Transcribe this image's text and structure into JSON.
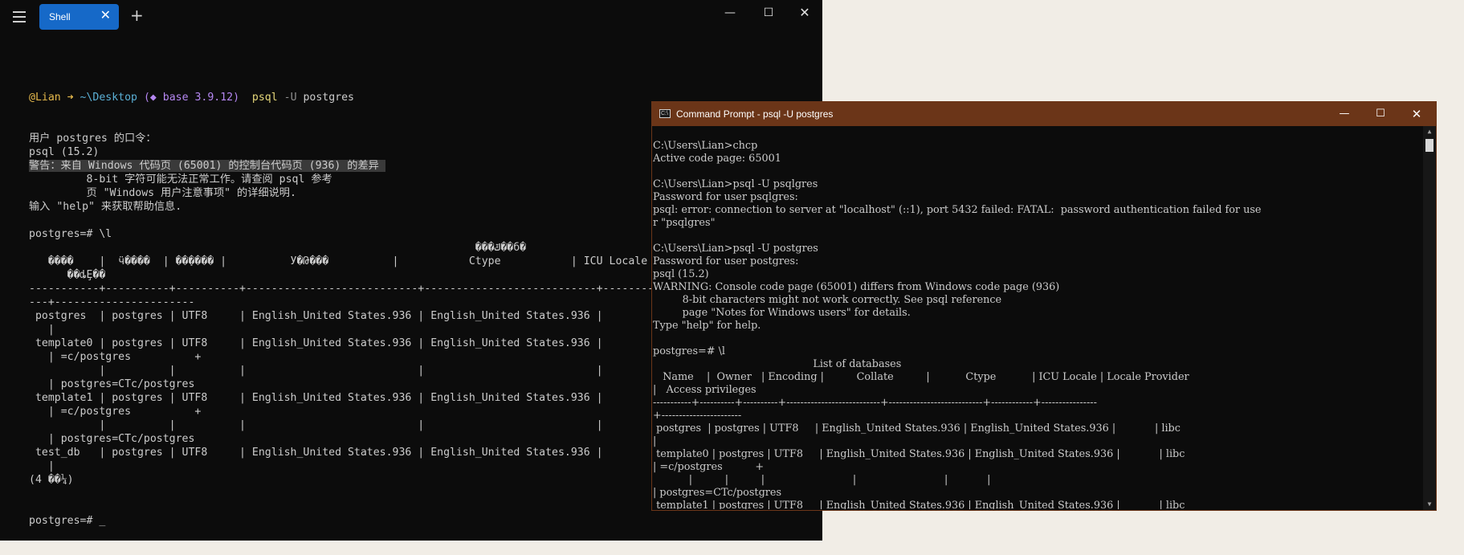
{
  "terminal": {
    "tab_label": "Shell",
    "tab_close": "✕",
    "new_tab": "+",
    "min": "—",
    "max": "☐",
    "close": "✕",
    "prompt": {
      "user": "@Lian",
      "arrow": " ➜ ",
      "dir": "~\\Desktop",
      "env": " (◆ base 3.9.12) ",
      "cmd": " psql",
      "flag": " -U ",
      "arg": "postgres"
    },
    "lines": [
      "用户 postgres 的口令：",
      "psql (15.2)",
      "警告：来自 Windows 代码页 (65001) 的控制台代码页 (936) 的差异 ",
      "         8-bit 字符可能无法正常工作。请查阅 psql 参考",
      "         页 \"Windows 用户注意事项\" 的详细说明.",
      "输入 \"help\" 来获取帮助信息.",
      "",
      "postgres=# \\l",
      "                                                                      ���ݿ��б�",
      "   ����    |  ӵ����  | ��ַ���� |          У�Թ���          |           Ctype           | ICU Locale",
      "      ��ȡȨ��",
      "-----------+----------+----------+---------------------------+---------------------------+------------",
      "---+----------------------",
      " postgres  | postgres | UTF8     | English_United States.936 | English_United States.936 |",
      "   |",
      " template0 | postgres | UTF8     | English_United States.936 | English_United States.936 |",
      "   | =c/postgres          +",
      "           |          |          |                           |                           |",
      "   | postgres=CTc/postgres",
      " template1 | postgres | UTF8     | English_United States.936 | English_United States.936 |",
      "   | =c/postgres          +",
      "           |          |          |                           |                           |",
      "   | postgres=CTc/postgres",
      " test_db   | postgres | UTF8     | English_United States.936 | English_United States.936 |",
      "   |",
      "(4 ��¼)",
      "",
      "",
      "postgres=# _"
    ]
  },
  "cmd": {
    "icon": "C:\\",
    "title": "Command Prompt - psql  -U postgres",
    "min": "—",
    "max": "☐",
    "close": "✕",
    "lines": [
      "C:\\Users\\Lian>chcp",
      "Active code page: 65001",
      "",
      "C:\\Users\\Lian>psql -U psqlgres",
      "Password for user psqlgres:",
      "psql: error: connection to server at \"localhost\" (::1), port 5432 failed: FATAL:  password authentication failed for use",
      "r \"psqlgres\"",
      "",
      "C:\\Users\\Lian>psql -U postgres",
      "Password for user postgres:",
      "psql (15.2)",
      "WARNING: Console code page (65001) differs from Windows code page (936)",
      "         8-bit characters might not work correctly. See psql reference",
      "         page \"Notes for Windows users\" for details.",
      "Type \"help\" for help.",
      "",
      "postgres=# \\l",
      "                                                 List of databases",
      "   Name    |  Owner   | Encoding |          Collate          |           Ctype           | ICU Locale | Locale Provider",
      "|   Access privileges",
      "-----------+----------+----------+---------------------------+---------------------------+------------+----------------",
      "+-----------------------",
      " postgres  | postgres | UTF8     | English_United States.936 | English_United States.936 |            | libc",
      "|",
      " template0 | postgres | UTF8     | English_United States.936 | English_United States.936 |            | libc",
      "| =c/postgres          +",
      "           |          |          |                           |                           |            |",
      "| postgres=CTc/postgres",
      " template1 | postgres | UTF8     | English_United States.936 | English_United States.936 |            | libc"
    ]
  }
}
